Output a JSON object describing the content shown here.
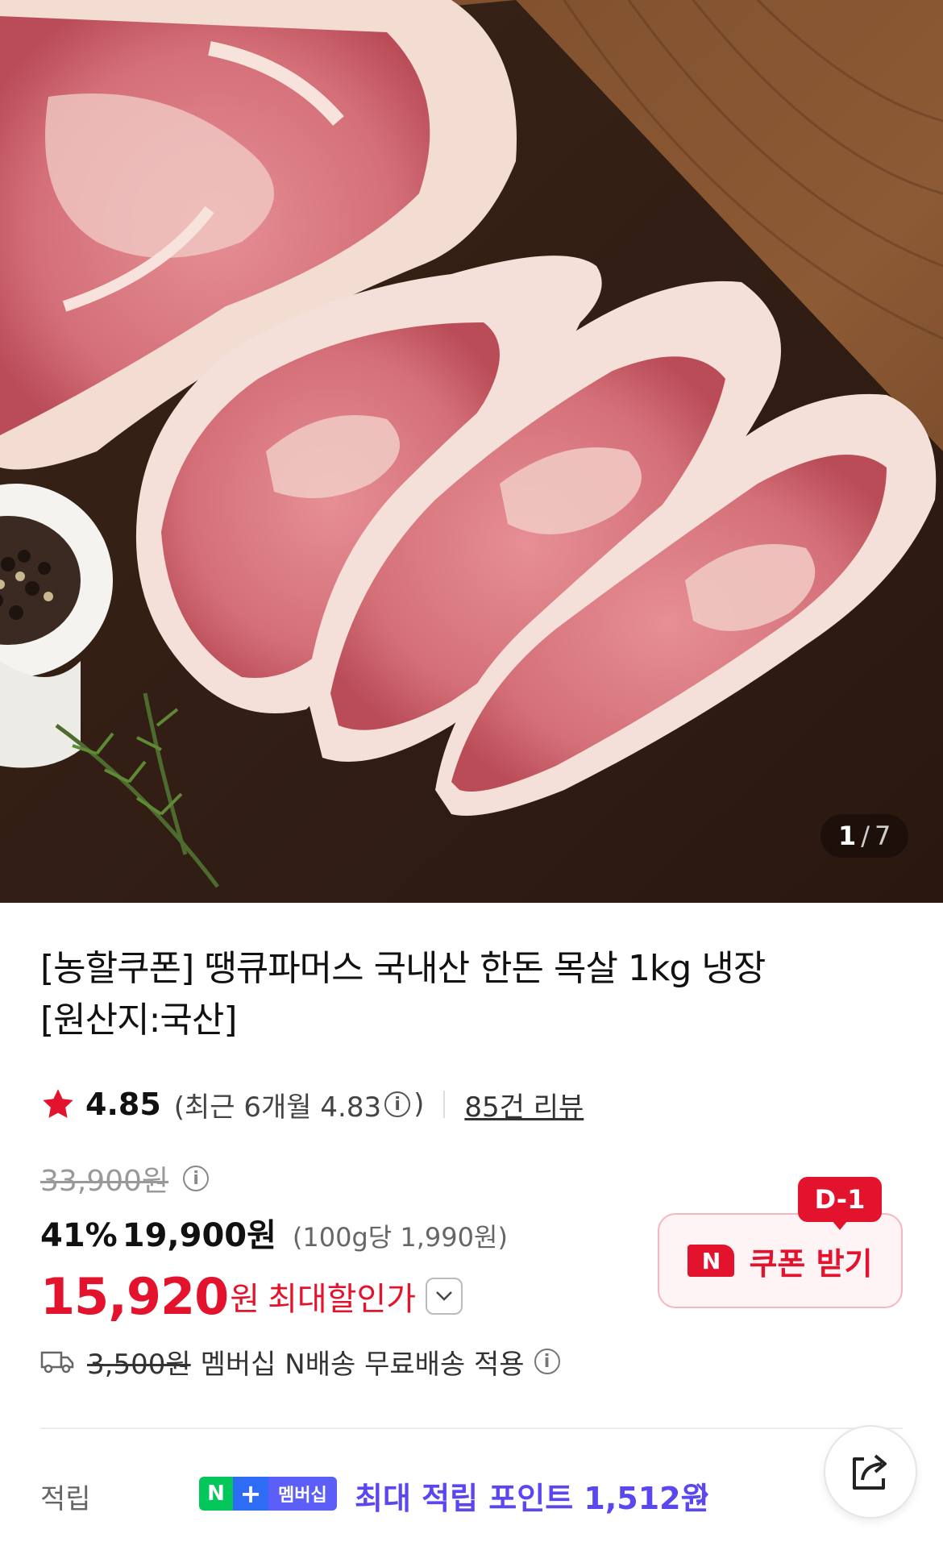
{
  "gallery": {
    "current": "1",
    "separator": "/",
    "total": "7"
  },
  "product": {
    "title_line1": "[농할쿠폰] 땡큐파머스 국내산 한돈 목살 1kg 냉장",
    "title_line2": "[원산지:국산]",
    "rating": "4.85",
    "recent_rating_prefix": "(최근 6개월 4.83",
    "recent_rating_suffix": ")",
    "review_link": "85건 리뷰",
    "original_price": "33,900원",
    "discount_rate": "41%",
    "sale_price": "19,900원",
    "unit_price": "(100g당 1,990원)",
    "max_discount_price": "15,920",
    "max_discount_won": "원",
    "max_discount_label": "최대할인가"
  },
  "coupon": {
    "dday": "D-1",
    "badge": "N",
    "label": "쿠폰 받기"
  },
  "shipping": {
    "fee": "3,500원",
    "note": "멤버십 N배송 무료배송 적용"
  },
  "points": {
    "label": "적립",
    "badge_n": "N",
    "badge_plus": "+",
    "badge_text": "멤버십",
    "text": "최대 적립 포인트 1,512원"
  },
  "colors": {
    "accent_red": "#e3132d",
    "membership_purple": "#5b47f0",
    "naver_green": "#03c75a"
  },
  "icons": [
    "star-icon",
    "info-icon",
    "chevron-down-icon",
    "truck-icon",
    "chevron-right-icon",
    "share-icon"
  ]
}
